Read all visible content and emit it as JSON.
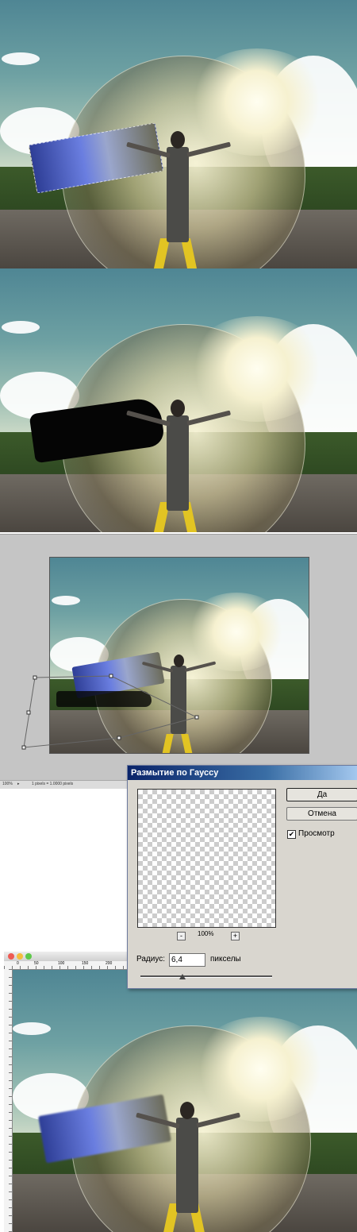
{
  "dialog": {
    "title": "Размытие по Гауссу",
    "ok_label": "Да",
    "cancel_label": "Отмена",
    "preview_checkbox_label": "Просмотр",
    "preview_checked": true,
    "zoom_out_label": "-",
    "zoom_in_label": "+",
    "zoom_level": "100%",
    "radius_label": "Радиус:",
    "radius_value": "6,4",
    "radius_unit": "пикселы",
    "slider_level_fraction": 0.32
  },
  "photoshop_status": {
    "zoom": "100%",
    "info": "1 pixels = 1.0000 pixels"
  },
  "ruler_ticks": [
    "0",
    "50",
    "100",
    "150",
    "200",
    "250",
    "300"
  ],
  "icons": [
    "close-dot-icon",
    "minimize-dot-icon",
    "zoom-dot-icon",
    "status-arrow-icon"
  ],
  "colors": {
    "title_bar_start": "#0a246a",
    "title_bar_end": "#a6caf0",
    "mac_close": "#ee5a52",
    "mac_minimize": "#f4bd3c",
    "mac_zoom": "#5ec94a",
    "road_stripe": "#e2c423"
  }
}
